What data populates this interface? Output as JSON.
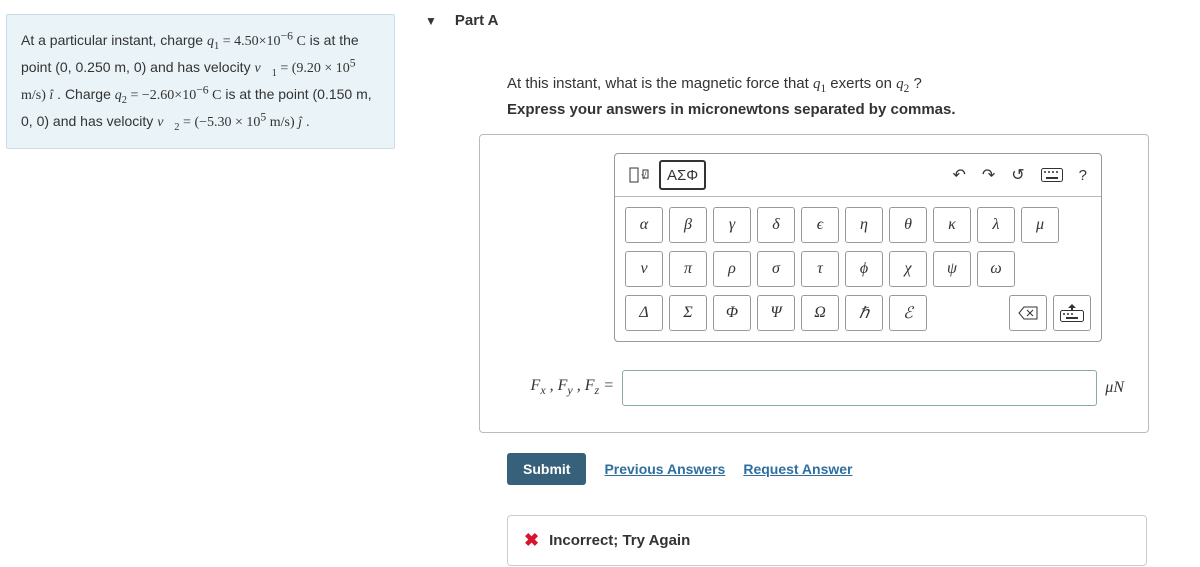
{
  "problem": {
    "html": "At a particular instant, charge <span class='math'><i>q</i><sub>1</sub> = 4.50×10<sup>−6</sup> C</span> is at the point (0, 0.250 m, 0) and has velocity <span class='math'><i>v&#8407;</i><sub>1</sub> = (9.20 × 10<sup>5</sup> m/s) <i>î</i></span> . Charge <span class='math'><i>q</i><sub>2</sub> = −2.60×10<sup>−6</sup> C</span> is at the point (0.150 m, 0, 0) and has velocity <span class='math'><i>v&#8407;</i><sub>2</sub> = (−5.30 × 10<sup>5</sup> m/s) <i>ĵ</i></span> ."
  },
  "part": {
    "label": "Part A",
    "prompt_html": "At this instant, what is the magnetic force that <span class='math'><i>q</i><sub>1</sub></span> exerts on <span class='math'><i>q</i><sub>2</sub></span> ?",
    "instruction": "Express your answers in micronewtons separated by commas."
  },
  "toolbar": {
    "template_label": "□√□",
    "greek_tab": "ΑΣΦ",
    "help": "?"
  },
  "greek": {
    "row1": [
      "α",
      "β",
      "γ",
      "δ",
      "ϵ",
      "η",
      "θ",
      "κ",
      "λ",
      "μ"
    ],
    "row2": [
      "ν",
      "π",
      "ρ",
      "σ",
      "τ",
      "ϕ",
      "χ",
      "ψ",
      "ω"
    ],
    "row3": [
      "Δ",
      "Σ",
      "Φ",
      "Ψ",
      "Ω",
      "ℏ",
      "ℰ"
    ]
  },
  "input": {
    "lhs_html": "<i>F<sub>x</sub></i> , <i>F<sub>y</sub></i> , <i>F<sub>z</sub></i> =",
    "value": "",
    "unit": "μN"
  },
  "actions": {
    "submit": "Submit",
    "previous": "Previous Answers",
    "request": "Request Answer"
  },
  "feedback": {
    "text": "Incorrect; Try Again"
  }
}
